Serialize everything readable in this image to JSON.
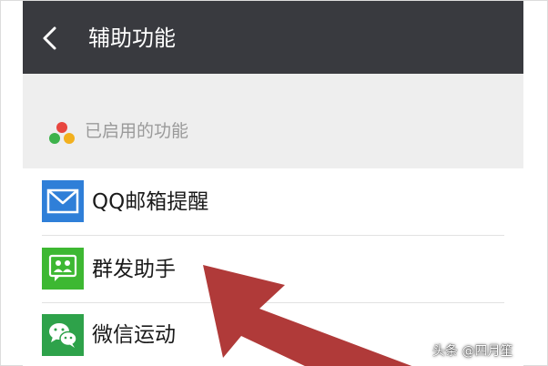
{
  "topbar": {
    "back_icon": "chevron-left-icon",
    "title": "辅助功能",
    "background": "#393a3f"
  },
  "section": {
    "icon": "three-dots-icon",
    "title": "已启用的功能",
    "dot_colors": [
      "#e8463f",
      "#f2b01e",
      "#3db24b"
    ]
  },
  "items": [
    {
      "label": "QQ邮箱提醒",
      "icon": "mail-icon",
      "color": "#2f7fd8"
    },
    {
      "label": "群发助手",
      "icon": "group-chat-icon",
      "color": "#3db832"
    },
    {
      "label": "微信运动",
      "icon": "wechat-icon",
      "color": "#2ea24a"
    }
  ],
  "annotation": {
    "arrow_color": "#b03a39"
  },
  "watermark": {
    "text": "头条 @四月笙"
  }
}
